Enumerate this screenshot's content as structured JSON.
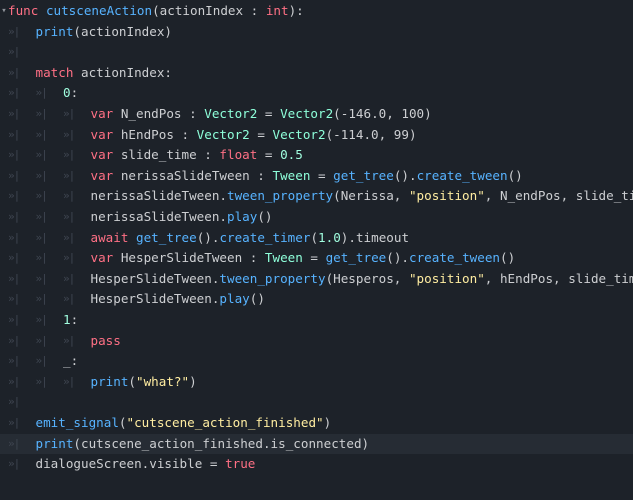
{
  "editor": {
    "language": "GDScript",
    "colors": {
      "background": "#1d2229",
      "current_line": "#262c34",
      "keyword": "#ff7085",
      "function": "#57b3ff",
      "type": "#8effda",
      "number": "#a1ffe0",
      "string": "#ffeda1",
      "text": "#cdcfd2",
      "indent_guide": "#3e4550"
    },
    "indent_marker": "»|",
    "fold_icon": "chevron-down-icon",
    "current_line_index": 21,
    "lines": [
      {
        "indent": 0,
        "fold": true,
        "tokens": [
          {
            "t": "func",
            "c": "kw"
          },
          {
            "t": " ",
            "c": "id"
          },
          {
            "t": "cutsceneAction",
            "c": "fn"
          },
          {
            "t": "(actionIndex : ",
            "c": "id"
          },
          {
            "t": "int",
            "c": "kw"
          },
          {
            "t": "):",
            "c": "id"
          }
        ]
      },
      {
        "indent": 1,
        "tokens": [
          {
            "t": "print",
            "c": "fn"
          },
          {
            "t": "(actionIndex)",
            "c": "id"
          }
        ]
      },
      {
        "indent": 1,
        "tokens": []
      },
      {
        "indent": 1,
        "tokens": [
          {
            "t": "match",
            "c": "kw"
          },
          {
            "t": " actionIndex:",
            "c": "id"
          }
        ]
      },
      {
        "indent": 2,
        "tokens": [
          {
            "t": "0",
            "c": "num"
          },
          {
            "t": ":",
            "c": "id"
          }
        ]
      },
      {
        "indent": 3,
        "tokens": [
          {
            "t": "var",
            "c": "kw"
          },
          {
            "t": " N_endPos : ",
            "c": "id"
          },
          {
            "t": "Vector2",
            "c": "ty"
          },
          {
            "t": " = ",
            "c": "id"
          },
          {
            "t": "Vector2",
            "c": "ty"
          },
          {
            "t": "(-146.0, 100)",
            "c": "id"
          }
        ]
      },
      {
        "indent": 3,
        "tokens": [
          {
            "t": "var",
            "c": "kw"
          },
          {
            "t": " hEndPos : ",
            "c": "id"
          },
          {
            "t": "Vector2",
            "c": "ty"
          },
          {
            "t": " = ",
            "c": "id"
          },
          {
            "t": "Vector2",
            "c": "ty"
          },
          {
            "t": "(-114.0, 99)",
            "c": "id"
          }
        ]
      },
      {
        "indent": 3,
        "tokens": [
          {
            "t": "var",
            "c": "kw"
          },
          {
            "t": " slide_time : ",
            "c": "id"
          },
          {
            "t": "float",
            "c": "kw"
          },
          {
            "t": " = ",
            "c": "id"
          },
          {
            "t": "0.5",
            "c": "num"
          }
        ]
      },
      {
        "indent": 3,
        "tokens": [
          {
            "t": "var",
            "c": "kw"
          },
          {
            "t": " nerissaSlideTween : ",
            "c": "id"
          },
          {
            "t": "Tween",
            "c": "ty"
          },
          {
            "t": " = ",
            "c": "id"
          },
          {
            "t": "get_tree",
            "c": "fn"
          },
          {
            "t": "().",
            "c": "id"
          },
          {
            "t": "create_tween",
            "c": "fn"
          },
          {
            "t": "()",
            "c": "id"
          }
        ]
      },
      {
        "indent": 3,
        "tokens": [
          {
            "t": "nerissaSlideTween.",
            "c": "id"
          },
          {
            "t": "tween_property",
            "c": "fn"
          },
          {
            "t": "(Nerissa, ",
            "c": "id"
          },
          {
            "t": "\"position\"",
            "c": "str"
          },
          {
            "t": ", N_endPos, slide_time)",
            "c": "id"
          }
        ]
      },
      {
        "indent": 3,
        "tokens": [
          {
            "t": "nerissaSlideTween.",
            "c": "id"
          },
          {
            "t": "play",
            "c": "fn"
          },
          {
            "t": "()",
            "c": "id"
          }
        ]
      },
      {
        "indent": 3,
        "tokens": [
          {
            "t": "await",
            "c": "kw"
          },
          {
            "t": " ",
            "c": "id"
          },
          {
            "t": "get_tree",
            "c": "fn"
          },
          {
            "t": "().",
            "c": "id"
          },
          {
            "t": "create_timer",
            "c": "fn"
          },
          {
            "t": "(",
            "c": "id"
          },
          {
            "t": "1.0",
            "c": "num"
          },
          {
            "t": ").timeout",
            "c": "id"
          }
        ]
      },
      {
        "indent": 3,
        "tokens": [
          {
            "t": "var",
            "c": "kw"
          },
          {
            "t": " HesperSlideTween : ",
            "c": "id"
          },
          {
            "t": "Tween",
            "c": "ty"
          },
          {
            "t": " = ",
            "c": "id"
          },
          {
            "t": "get_tree",
            "c": "fn"
          },
          {
            "t": "().",
            "c": "id"
          },
          {
            "t": "create_tween",
            "c": "fn"
          },
          {
            "t": "()",
            "c": "id"
          }
        ]
      },
      {
        "indent": 3,
        "tokens": [
          {
            "t": "HesperSlideTween.",
            "c": "id"
          },
          {
            "t": "tween_property",
            "c": "fn"
          },
          {
            "t": "(Hesperos, ",
            "c": "id"
          },
          {
            "t": "\"position\"",
            "c": "str"
          },
          {
            "t": ", hEndPos, slide_time)",
            "c": "id"
          }
        ]
      },
      {
        "indent": 3,
        "tokens": [
          {
            "t": "HesperSlideTween.",
            "c": "id"
          },
          {
            "t": "play",
            "c": "fn"
          },
          {
            "t": "()",
            "c": "id"
          }
        ]
      },
      {
        "indent": 2,
        "tokens": [
          {
            "t": "1",
            "c": "num"
          },
          {
            "t": ":",
            "c": "id"
          }
        ]
      },
      {
        "indent": 3,
        "tokens": [
          {
            "t": "pass",
            "c": "kw"
          }
        ]
      },
      {
        "indent": 2,
        "tokens": [
          {
            "t": "_:",
            "c": "id"
          }
        ]
      },
      {
        "indent": 3,
        "tokens": [
          {
            "t": "print",
            "c": "fn"
          },
          {
            "t": "(",
            "c": "id"
          },
          {
            "t": "\"what?\"",
            "c": "str"
          },
          {
            "t": ")",
            "c": "id"
          }
        ]
      },
      {
        "indent": 1,
        "tokens": []
      },
      {
        "indent": 1,
        "tokens": [
          {
            "t": "emit_signal",
            "c": "fn"
          },
          {
            "t": "(",
            "c": "id"
          },
          {
            "t": "\"cutscene_action_finished\"",
            "c": "str"
          },
          {
            "t": ")",
            "c": "id"
          }
        ]
      },
      {
        "indent": 1,
        "tokens": [
          {
            "t": "print",
            "c": "fn"
          },
          {
            "t": "(cutscene_action_finished.is_connected)",
            "c": "id"
          }
        ]
      },
      {
        "indent": 1,
        "tokens": [
          {
            "t": "dialogueScreen.visible = ",
            "c": "id"
          },
          {
            "t": "true",
            "c": "kw"
          }
        ]
      }
    ]
  }
}
